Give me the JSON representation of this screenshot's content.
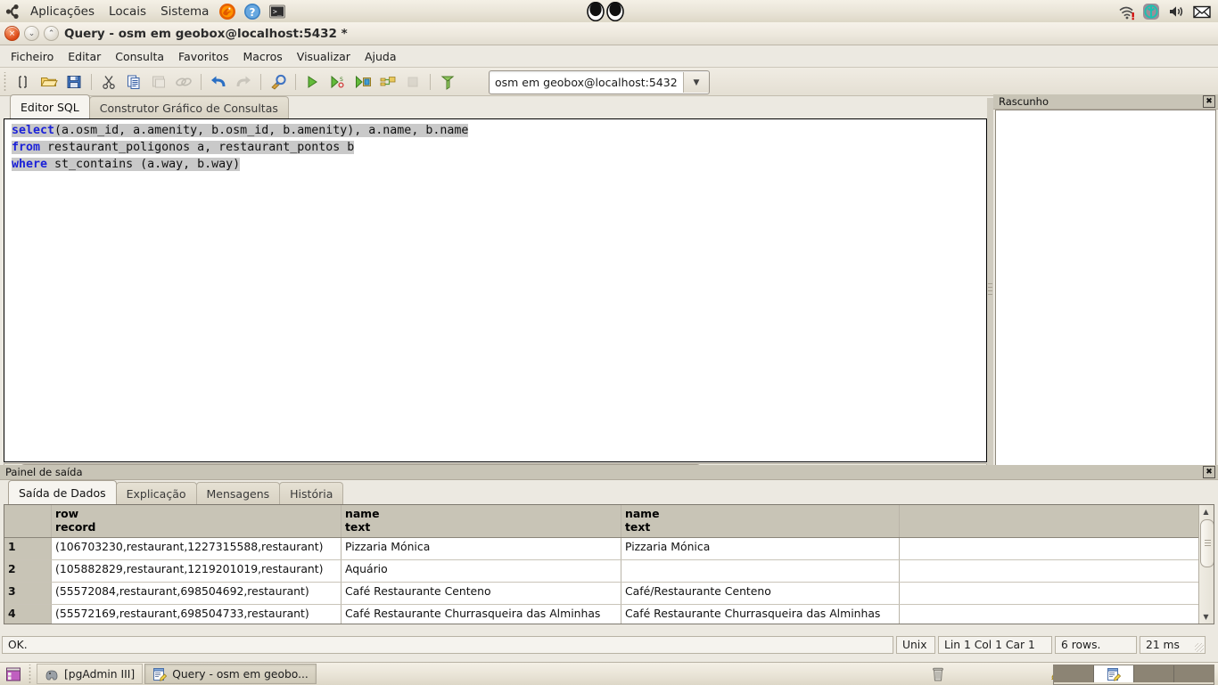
{
  "panel": {
    "logo_icon": "ubuntu-logo-icon",
    "menus": [
      "Aplicações",
      "Locais",
      "Sistema"
    ],
    "launchers": [
      {
        "name": "firefox-launcher-icon"
      },
      {
        "name": "help-launcher-icon"
      },
      {
        "name": "terminal-launcher-icon"
      }
    ],
    "center_applet": "xeyes-applet-icon",
    "tray": [
      {
        "name": "network-wireless-error-icon"
      },
      {
        "name": "ubuntu-one-icon"
      },
      {
        "name": "volume-icon"
      },
      {
        "name": "mail-icon"
      }
    ]
  },
  "window": {
    "title": "Query - osm em geobox@localhost:5432 *",
    "buttons": {
      "close": "×",
      "minimize": "⌄",
      "maximize": "⌃"
    }
  },
  "menubar": {
    "items": [
      "Ficheiro",
      "Editar",
      "Consulta",
      "Favoritos",
      "Macros",
      "Visualizar",
      "Ajuda"
    ]
  },
  "toolbar": {
    "buttons": [
      {
        "name": "new-query-icon",
        "enabled": true
      },
      {
        "name": "open-file-icon",
        "enabled": true
      },
      {
        "name": "save-file-icon",
        "enabled": true
      },
      {
        "name": "cut-icon",
        "enabled": true
      },
      {
        "name": "copy-icon",
        "enabled": true
      },
      {
        "name": "paste-icon",
        "enabled": false
      },
      {
        "name": "find-replace-icon",
        "enabled": false
      },
      {
        "name": "undo-icon",
        "enabled": true
      },
      {
        "name": "redo-icon",
        "enabled": false
      },
      {
        "name": "explain-options-icon",
        "enabled": true
      },
      {
        "name": "execute-query-icon",
        "enabled": true
      },
      {
        "name": "execute-pgscript-icon",
        "enabled": true
      },
      {
        "name": "execute-to-file-icon",
        "enabled": true
      },
      {
        "name": "explain-query-icon",
        "enabled": true
      },
      {
        "name": "cancel-query-icon",
        "enabled": false
      },
      {
        "name": "clear-window-icon",
        "enabled": true
      }
    ],
    "connection": {
      "value": "osm em geobox@localhost:5432",
      "arrow": "▼"
    }
  },
  "editor": {
    "tabs": [
      {
        "label": "Editor SQL",
        "active": true
      },
      {
        "label": "Construtor Gráfico de Consultas",
        "active": false
      }
    ],
    "sql_lines": [
      {
        "keyword": "select",
        "rest": "(a.osm_id, a.amenity, b.osm_id, b.amenity), a.name, b.name"
      },
      {
        "keyword": "from",
        "rest": " restaurant_poligonos a, restaurant_pontos b"
      },
      {
        "keyword": "where",
        "rest": " st_contains (a.way, b.way)"
      }
    ],
    "scroll_left_arrow": "◀",
    "scroll_right_arrow": "▶"
  },
  "rascunho": {
    "title": "Rascunho",
    "close_label": "✖",
    "content": ""
  },
  "output": {
    "title": "Painel de saída",
    "close_label": "✖",
    "tabs": [
      {
        "label": "Saída de Dados",
        "active": true
      },
      {
        "label": "Explicação",
        "active": false
      },
      {
        "label": "Mensagens",
        "active": false
      },
      {
        "label": "História",
        "active": false
      }
    ],
    "grid": {
      "columns": [
        {
          "name": "",
          "type": ""
        },
        {
          "name": "row",
          "type": "record"
        },
        {
          "name": "name",
          "type": "text"
        },
        {
          "name": "name",
          "type": "text"
        },
        {
          "name": "",
          "type": ""
        }
      ],
      "rows": [
        {
          "num": "1",
          "cells": [
            "(106703230,restaurant,1227315588,restaurant)",
            "Pizzaria Mónica",
            "Pizzaria Mónica",
            ""
          ]
        },
        {
          "num": "2",
          "cells": [
            "(105882829,restaurant,1219201019,restaurant)",
            "Aquário",
            "",
            ""
          ]
        },
        {
          "num": "3",
          "cells": [
            "(55572084,restaurant,698504692,restaurant)",
            "Café Restaurante Centeno",
            "Café/Restaurante Centeno",
            ""
          ]
        },
        {
          "num": "4",
          "cells": [
            "(55572169,restaurant,698504733,restaurant)",
            "Café Restaurante Churrasqueira das Alminhas",
            "Café Restaurante Churrasqueira das Alminhas",
            ""
          ]
        }
      ]
    }
  },
  "statusbar": {
    "message": "OK.",
    "line_endings": "Unix",
    "position": "Lin 1 Col 1 Car 1",
    "rows": "6 rows.",
    "time": "21 ms"
  },
  "taskbar": {
    "show_desktop_icon": "show-desktop-icon",
    "tasks": [
      {
        "label": "[pgAdmin III]",
        "icon": "pgadmin-elephant-icon",
        "active": false
      },
      {
        "label": "Query - osm em geobo...",
        "icon": "query-window-icon",
        "active": true
      }
    ],
    "trash_icon": "trash-icon",
    "notes_icon": "notes-icon",
    "workspaces": [
      {
        "active": false
      },
      {
        "active": true
      },
      {
        "active": false
      },
      {
        "active": false
      }
    ]
  },
  "colors": {
    "accent_orange": "#dd4814",
    "keyword_blue": "#1c22d8",
    "selection_grey": "#c9c9c9",
    "panel_bg": "#ece9e1",
    "header_bg": "#c8c4b6"
  }
}
